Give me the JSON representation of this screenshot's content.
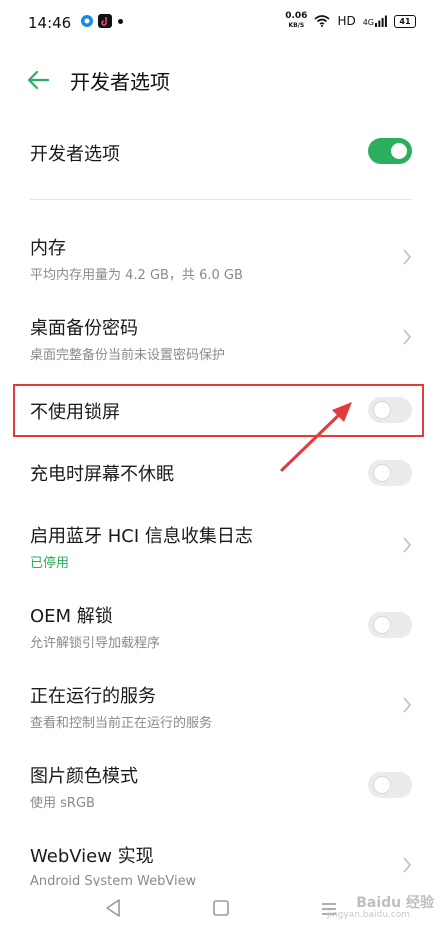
{
  "status_bar": {
    "time": "14:46",
    "net_speed_value": "0.06",
    "net_speed_unit": "KB/S",
    "hd": "HD",
    "signal": "4G",
    "battery": "41"
  },
  "header": {
    "title": "开发者选项"
  },
  "master_toggle": {
    "label": "开发者选项",
    "state": "on"
  },
  "items": [
    {
      "title": "内存",
      "subtitle": "平均内存用量为 4.2 GB，共 6.0 GB",
      "control": "chevron"
    },
    {
      "title": "桌面备份密码",
      "subtitle": "桌面完整备份当前未设置密码保护",
      "control": "chevron"
    },
    {
      "title": "不使用锁屏",
      "control": "switch-off"
    },
    {
      "title": "充电时屏幕不休眠",
      "control": "switch-off"
    },
    {
      "title": "启用蓝牙 HCI 信息收集日志",
      "subtitle": "已停用",
      "control": "chevron"
    },
    {
      "title": "OEM 解锁",
      "subtitle": "允许解锁引导加载程序",
      "control": "switch-off"
    },
    {
      "title": "正在运行的服务",
      "subtitle": "查看和控制当前正在运行的服务",
      "control": "chevron"
    },
    {
      "title": "图片颜色模式",
      "subtitle": "使用 sRGB",
      "control": "switch-off"
    },
    {
      "title": "WebView 实现",
      "subtitle": "Android System WebView",
      "control": "chevron"
    }
  ],
  "watermark": {
    "text": "Baidu 经验",
    "sub": "jingyan.baidu.com"
  },
  "colors": {
    "accent": "#2dae5f",
    "highlight": "#e23b3b"
  }
}
